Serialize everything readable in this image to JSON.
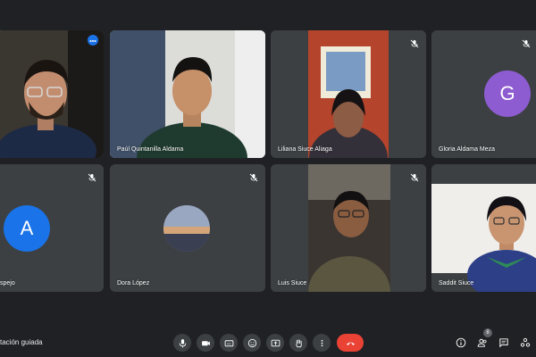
{
  "colors": {
    "background": "#202124",
    "tile": "#3c4043",
    "active_outline": "#8ab4f8",
    "avatar_g": "#8e5cd1",
    "avatar_a": "#1a73e8",
    "end_call": "#ea4335"
  },
  "participants": [
    {
      "name": "",
      "icon": "more-options-icon"
    },
    {
      "name": "Paúl Quintanilla Aldama"
    },
    {
      "name": "Liliana Siuce Aliaga",
      "icon": "mic-off-icon"
    },
    {
      "name": "Gloria Aldama Meza",
      "avatar_letter": "G",
      "icon": "mic-off-icon"
    },
    {
      "name": "spejo",
      "avatar_letter": "A",
      "icon": "mic-off-icon"
    },
    {
      "name": "Dora López",
      "icon": "mic-off-icon"
    },
    {
      "name": "Luis Siuce",
      "icon": "mic-off-icon"
    },
    {
      "name": "Saddit Siuce"
    }
  ],
  "bottom_bar": {
    "meeting_name": "tación guiada",
    "participant_count": "8",
    "controls": [
      "mic-icon",
      "camera-icon",
      "captions-icon",
      "emoji-icon",
      "present-icon",
      "raise-hand-icon",
      "more-options-icon",
      "end-call-icon"
    ],
    "right_controls": [
      "info-icon",
      "people-icon",
      "chat-icon",
      "activities-icon"
    ]
  }
}
